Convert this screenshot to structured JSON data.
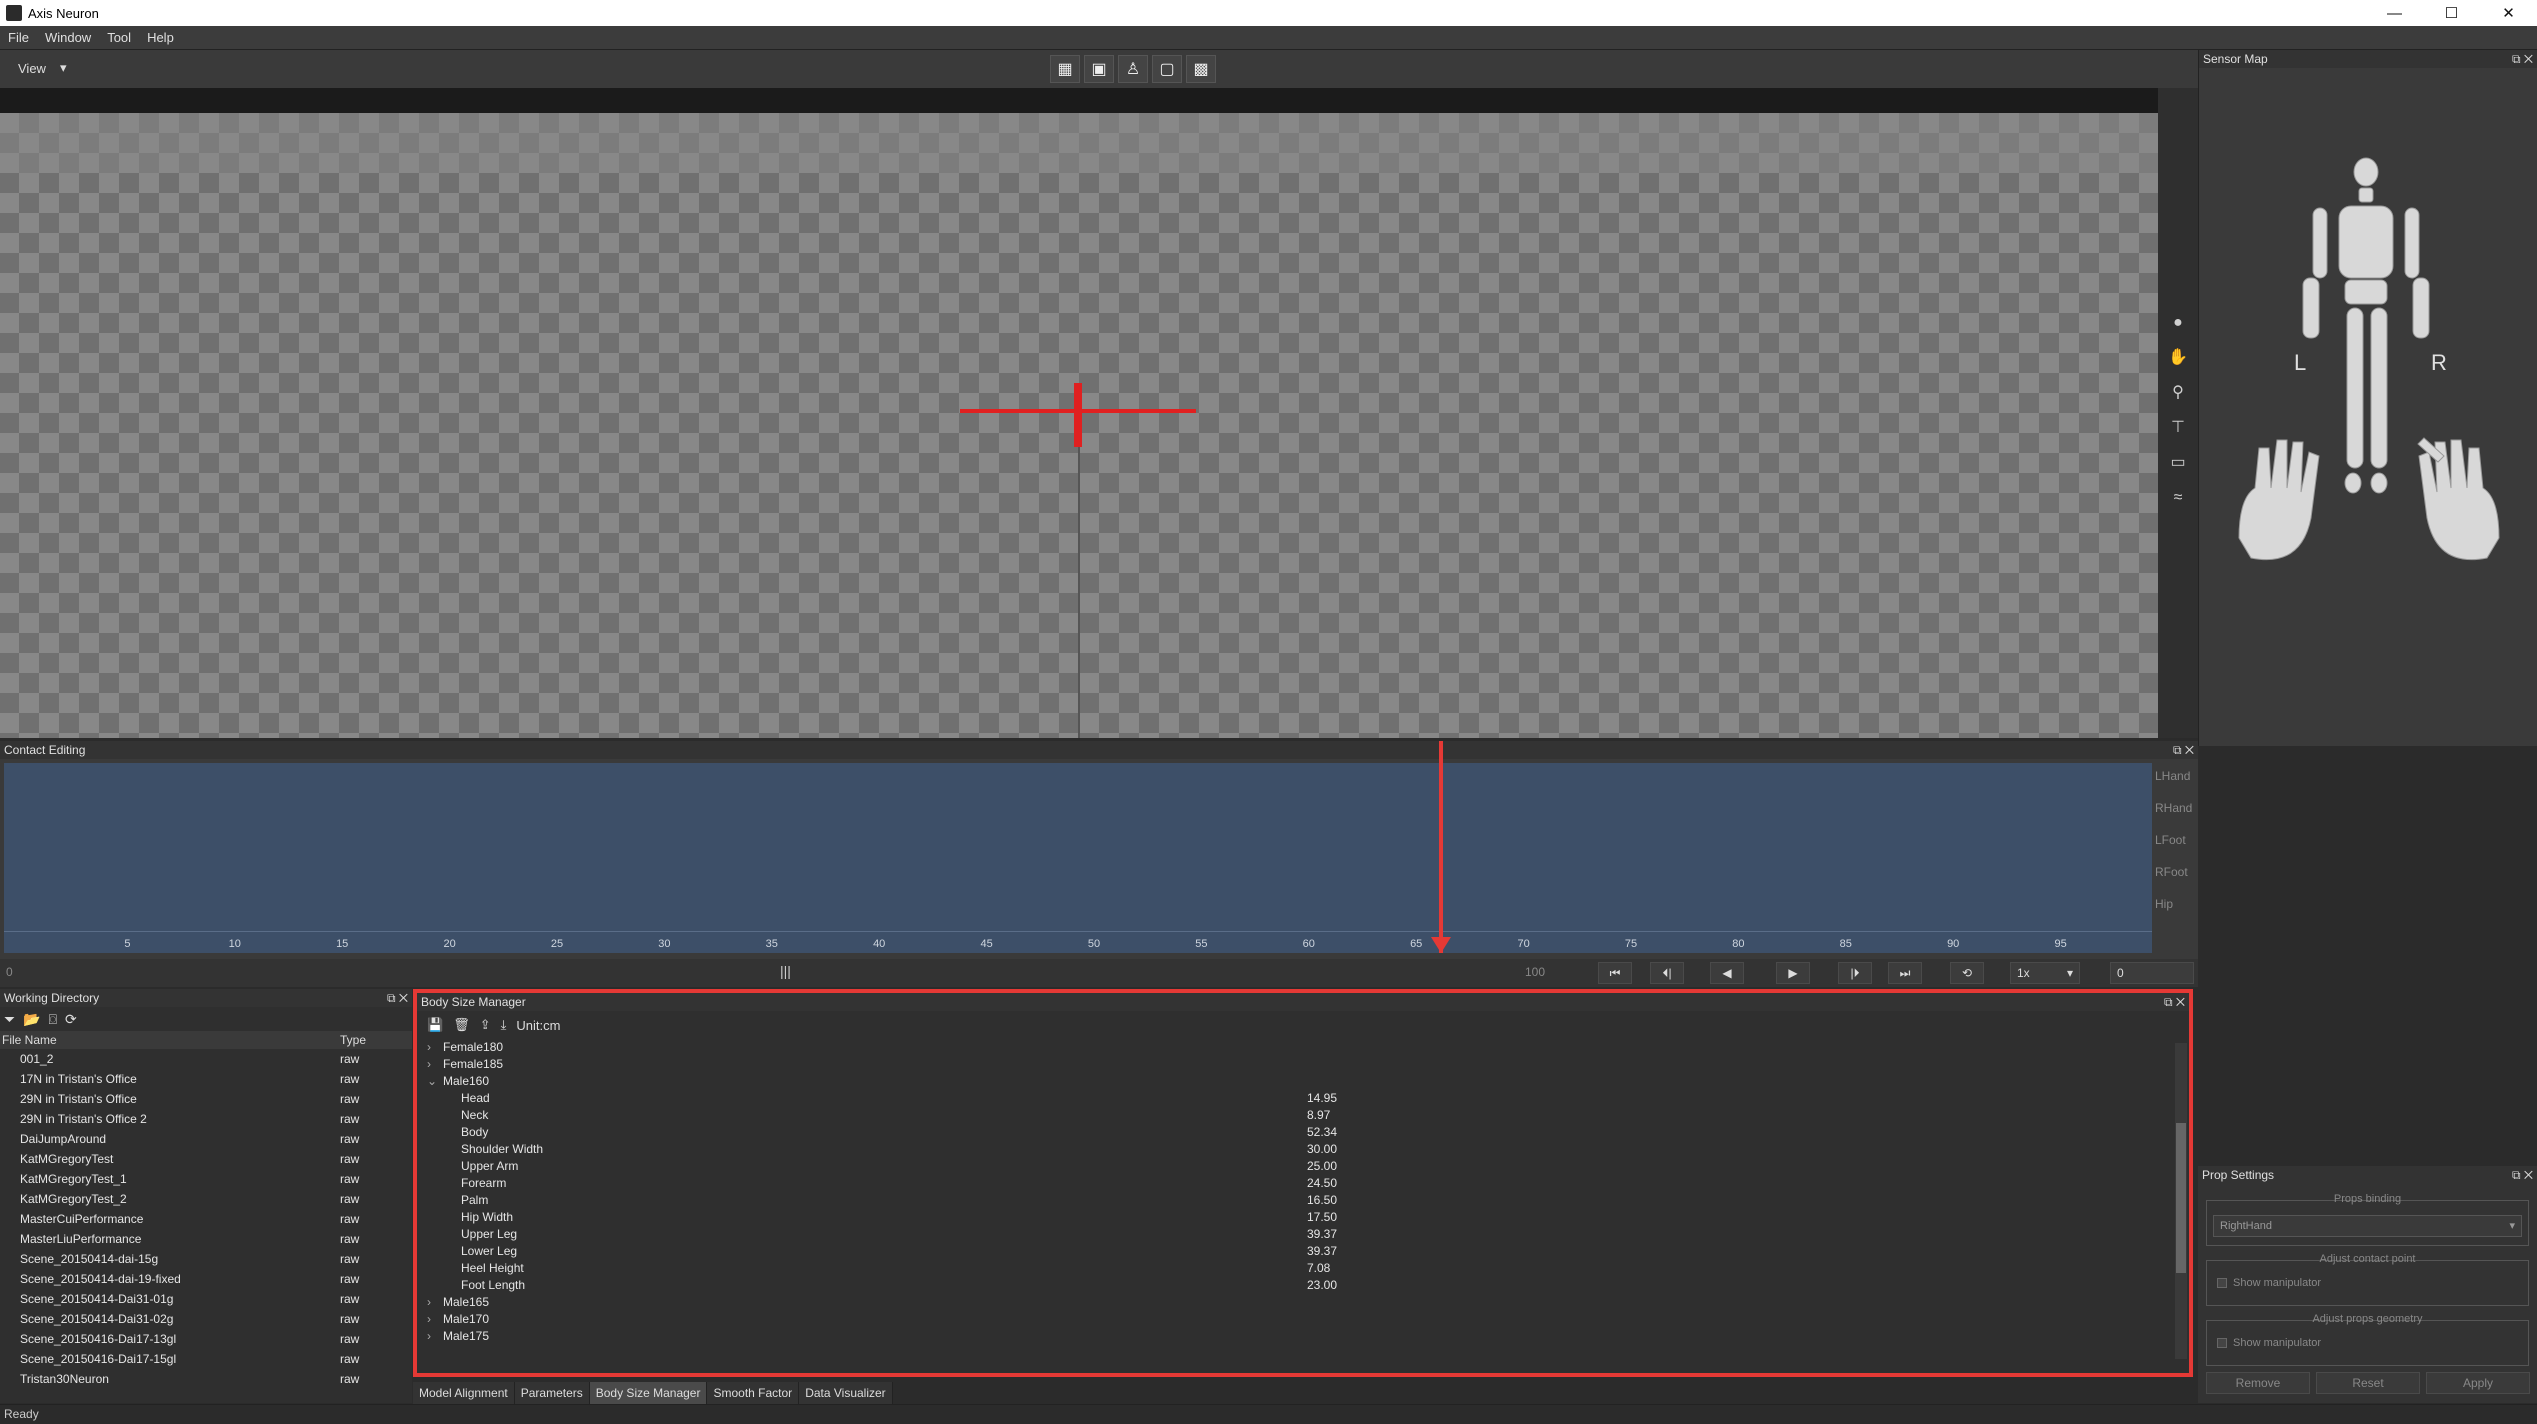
{
  "window": {
    "title": "Axis Neuron",
    "minimize": "—",
    "maximize": "☐",
    "close": "✕"
  },
  "menu": [
    "File",
    "Window",
    "Tool",
    "Help"
  ],
  "toolbar": {
    "view_label": "View",
    "view_arrow": "▾"
  },
  "viewport": {},
  "sensor_map": {
    "title": "Sensor Map",
    "left_label": "L",
    "right_label": "R"
  },
  "contact_editing": {
    "title": "Contact Editing",
    "tracks": [
      "LHand",
      "RHand",
      "LFoot",
      "RFoot",
      "Hip"
    ],
    "ruler_ticks": [
      "5",
      "10",
      "15",
      "20",
      "25",
      "30",
      "35",
      "40",
      "45",
      "50",
      "55",
      "60",
      "65",
      "70",
      "75",
      "80",
      "85",
      "90",
      "95"
    ],
    "start_value": "0",
    "end_value": "100",
    "speed": "1x",
    "frame_value": "0",
    "playhead_fraction": 0.669
  },
  "working_directory": {
    "title": "Working Directory",
    "columns": [
      "File Name",
      "Type"
    ],
    "rows": [
      {
        "name": "001_2",
        "type": "raw"
      },
      {
        "name": "17N in Tristan's Office",
        "type": "raw"
      },
      {
        "name": "29N in Tristan's Office",
        "type": "raw"
      },
      {
        "name": "29N in Tristan's Office 2",
        "type": "raw"
      },
      {
        "name": "DaiJumpAround",
        "type": "raw"
      },
      {
        "name": "KatMGregoryTest",
        "type": "raw"
      },
      {
        "name": "KatMGregoryTest_1",
        "type": "raw"
      },
      {
        "name": "KatMGregoryTest_2",
        "type": "raw"
      },
      {
        "name": "MasterCuiPerformance",
        "type": "raw"
      },
      {
        "name": "MasterLiuPerformance",
        "type": "raw"
      },
      {
        "name": "Scene_20150414-dai-15g",
        "type": "raw"
      },
      {
        "name": "Scene_20150414-dai-19-fixed",
        "type": "raw"
      },
      {
        "name": "Scene_20150414-Dai31-01g",
        "type": "raw"
      },
      {
        "name": "Scene_20150414-Dai31-02g",
        "type": "raw"
      },
      {
        "name": "Scene_20150416-Dai17-13gl",
        "type": "raw"
      },
      {
        "name": "Scene_20150416-Dai17-15gl",
        "type": "raw"
      },
      {
        "name": "Tristan30Neuron",
        "type": "raw"
      }
    ]
  },
  "body_size_manager": {
    "title": "Body Size Manager",
    "unit": "Unit:cm",
    "groups_before": [
      "Female180",
      "Female185"
    ],
    "expanded_group": "Male160",
    "rows": [
      {
        "name": "Head",
        "value": "14.95"
      },
      {
        "name": "Neck",
        "value": "8.97"
      },
      {
        "name": "Body",
        "value": "52.34"
      },
      {
        "name": "Shoulder Width",
        "value": "30.00"
      },
      {
        "name": "Upper Arm",
        "value": "25.00"
      },
      {
        "name": "Forearm",
        "value": "24.50"
      },
      {
        "name": "Palm",
        "value": "16.50"
      },
      {
        "name": "Hip Width",
        "value": "17.50"
      },
      {
        "name": "Upper Leg",
        "value": "39.37"
      },
      {
        "name": "Lower Leg",
        "value": "39.37"
      },
      {
        "name": "Heel Height",
        "value": "7.08"
      },
      {
        "name": "Foot Length",
        "value": "23.00"
      }
    ],
    "groups_after": [
      "Male165",
      "Male170",
      "Male175"
    ]
  },
  "bottom_tabs": [
    "Model Alignment",
    "Parameters",
    "Body Size Manager",
    "Smooth Factor",
    "Data Visualizer"
  ],
  "active_tab": "Body Size Manager",
  "prop_settings": {
    "title": "Prop Settings",
    "props_binding_label": "Props binding",
    "props_binding_value": "RightHand",
    "contact_point_label": "Adjust contact point",
    "geometry_label": "Adjust props geometry",
    "show_manipulator": "Show manipulator",
    "buttons": [
      "Remove",
      "Reset",
      "Apply"
    ]
  },
  "status": "Ready",
  "colors": {
    "highlight": "#e53935",
    "track": "#3d4f68"
  }
}
